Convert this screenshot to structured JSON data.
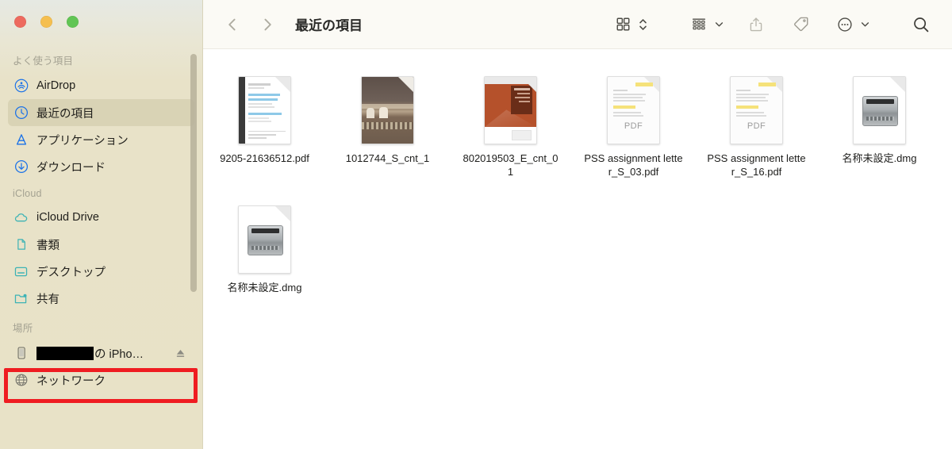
{
  "window": {
    "traffic_lights": [
      {
        "name": "close",
        "color": "#ED6A5E"
      },
      {
        "name": "minimize",
        "color": "#F5BF4F"
      },
      {
        "name": "maximize",
        "color": "#61C554"
      }
    ]
  },
  "toolbar": {
    "back_icon": "chevron-left-icon",
    "forward_icon": "chevron-right-icon",
    "title": "最近の項目",
    "view_icon": "grid-view-icon",
    "view_stepper_icon": "chevron-up-down-icon",
    "group_icon": "group-by-icon",
    "group_chevron_icon": "chevron-down-icon",
    "share_icon": "share-icon",
    "tag_icon": "tag-icon",
    "more_icon": "ellipsis-circle-icon",
    "more_chevron_icon": "chevron-down-icon",
    "search_icon": "search-icon"
  },
  "sidebar": {
    "accent_blue": "#1B72E8",
    "accent_teal": "#3DB3B5",
    "selected_bg": "#D9D3B5",
    "background": "#E8E2C7",
    "sections": [
      {
        "header": "よく使う項目",
        "items": [
          {
            "label": "AirDrop",
            "icon": "airdrop-icon",
            "selected": false
          },
          {
            "label": "最近の項目",
            "icon": "clock-icon",
            "selected": true
          },
          {
            "label": "アプリケーション",
            "icon": "applications-icon",
            "selected": false
          },
          {
            "label": "ダウンロード",
            "icon": "downloads-icon",
            "selected": false
          }
        ]
      },
      {
        "header": "iCloud",
        "items": [
          {
            "label": "iCloud Drive",
            "icon": "cloud-icon",
            "selected": false
          },
          {
            "label": "書類",
            "icon": "document-icon",
            "selected": false
          },
          {
            "label": "デスクトップ",
            "icon": "desktop-icon",
            "selected": false
          },
          {
            "label": "共有",
            "icon": "shared-folder-icon",
            "selected": false
          }
        ]
      },
      {
        "header": "場所",
        "items": [
          {
            "label": "の iPho…",
            "icon": "iphone-icon",
            "selected": false,
            "redacted": true,
            "eject_icon": "eject-icon",
            "highlighted": true
          },
          {
            "label": "ネットワーク",
            "icon": "network-globe-icon",
            "selected": false
          }
        ]
      }
    ],
    "scrollbar": {
      "visible": true
    }
  },
  "files": [
    {
      "name": "9205-21636512.pdf",
      "icon": "pdf-preview-icon",
      "kind": "preview-invoice"
    },
    {
      "name": "1012744_S_cnt_1",
      "icon": "photo-preview-icon",
      "kind": "preview-photo"
    },
    {
      "name": "802019503_E_cnt_01",
      "icon": "brochure-preview-icon",
      "kind": "preview-brochure"
    },
    {
      "name": "PSS assignment letter_S_03.pdf",
      "icon": "pdf-icon",
      "kind": "pdf",
      "badge": "PDF"
    },
    {
      "name": "PSS assignment letter_S_16.pdf",
      "icon": "pdf-icon",
      "kind": "pdf",
      "badge": "PDF"
    },
    {
      "name": "名称未設定.dmg",
      "icon": "dmg-disk-icon",
      "kind": "dmg"
    },
    {
      "name": "名称未設定.dmg",
      "icon": "dmg-disk-icon",
      "kind": "dmg"
    }
  ],
  "annotation": {
    "color": "#EF1C21",
    "target": "iphone-sidebar-item"
  }
}
